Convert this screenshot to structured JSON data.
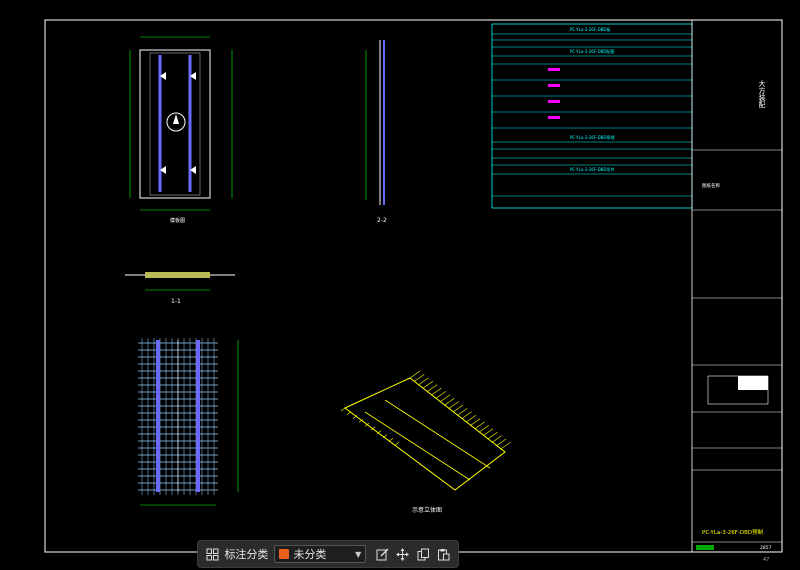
{
  "drawing": {
    "stamp_big": "大方装配",
    "project_label": "图纸名称",
    "part_code": "PC-YLa-3-26F-DBD预制",
    "sheet_no": "2857",
    "corner_num": "47",
    "section_22": "2-2",
    "section_11": "1-1",
    "iso_label": "示意立体图",
    "table_title_1": "PC-YLa-3-26F-DBD板",
    "table_title_2": "PC-YLa-3-26F-DBD配筋",
    "table_title_3": "PC-YLa-3-26F-DBD预埋",
    "table_title_4": "PC-YLa-3-26F-DBD吊件"
  },
  "toolbar": {
    "label": "标注分类",
    "selected_category": "未分类",
    "category_color": "#e8601c"
  },
  "colors": {
    "line": "#ffffff",
    "dim": "#00ff00",
    "bar": "#6a6aff",
    "table": "#00ffff",
    "highlight": "#ff00ff",
    "iso": "#ffff00"
  }
}
